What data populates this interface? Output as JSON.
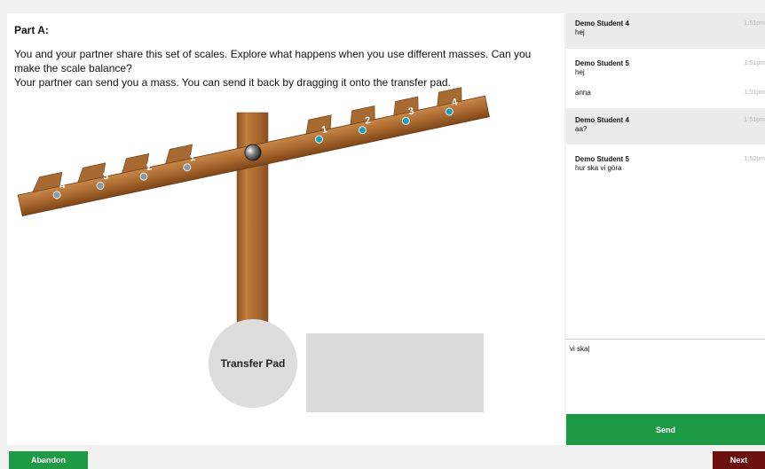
{
  "task": {
    "part_title": "Part A:",
    "instructions": [
      "You and your partner share this set of scales. Explore what happens when you use different masses. Can you make the scale balance?",
      "Your partner can send you a mass. You can send it back by dragging it onto the transfer pad."
    ],
    "transfer_pad_label": "Transfer Pad",
    "scale": {
      "left_positions": [
        "4",
        "3",
        "2",
        "1"
      ],
      "right_positions": [
        "1",
        "2",
        "3",
        "4"
      ],
      "colors": {
        "wood": "#a8692f",
        "left_peg": "#8e9aa2",
        "right_peg": "#1f9fb5"
      }
    }
  },
  "chat": {
    "messages": [
      {
        "sender": "Demo Student 4",
        "text": "hej",
        "time": "1:51pm"
      },
      {
        "sender": "Demo Student 5",
        "text": "hej",
        "time": "1:51pm"
      },
      {
        "sender": "",
        "text": "anna",
        "time": "1:51pm"
      },
      {
        "sender": "Demo Student 4",
        "text": "aa?",
        "time": "1:51pm"
      },
      {
        "sender": "Demo Student 5",
        "text": "hur ska vi göra",
        "time": "1:52pm"
      }
    ],
    "input_value": "vi ska|",
    "send_label": "Send"
  },
  "footer": {
    "abandon_label": "Abandon",
    "next_label": "Next"
  },
  "colors": {
    "accent_green": "#1d9a43",
    "next_red": "#6b0f0f"
  }
}
